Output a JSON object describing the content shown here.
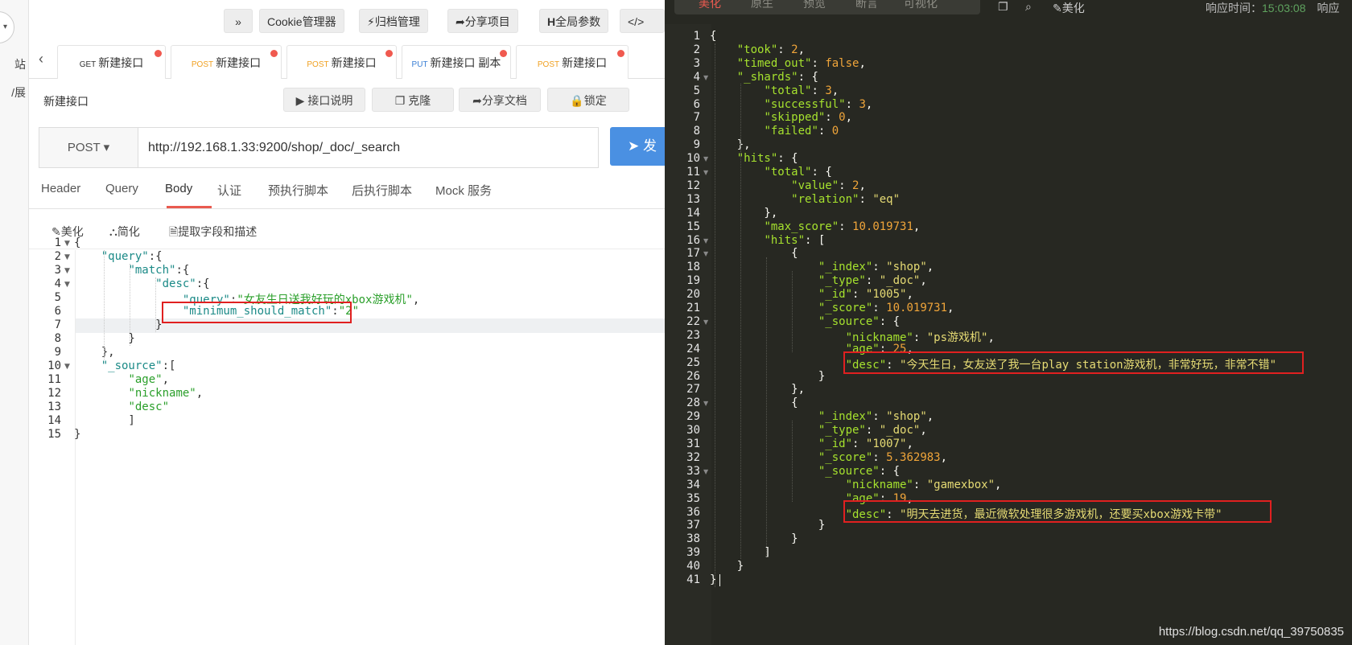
{
  "left_strip": {
    "circle_glyph": "▾",
    "items": [
      "站",
      "/展"
    ]
  },
  "toolbar": {
    "expand_label": "»",
    "cookie_label": "Cookie管理器",
    "archive_label": "归档管理",
    "share_project_label": "分享项目",
    "global_params_label": "全局参数",
    "code_label": "</>"
  },
  "request_tabs": [
    {
      "method": "GET",
      "label": "新建接口",
      "method_color": "#333333",
      "dot": true
    },
    {
      "method": "POST",
      "label": "新建接口",
      "method_color": "#f0a020",
      "dot": true
    },
    {
      "method": "POST",
      "label": "新建接口",
      "method_color": "#f0a020",
      "dot": true
    },
    {
      "method": "PUT",
      "label": "新建接口 副本",
      "method_color": "#3a7fd5",
      "dot": true
    },
    {
      "method": "POST",
      "label": "新建接口",
      "method_color": "#f0a020",
      "dot": true
    }
  ],
  "request": {
    "title": "新建接口",
    "doc_label": "接口说明",
    "clone_label": "克隆",
    "share_doc_label": "分享文档",
    "lock_label": "锁定",
    "method": "POST",
    "url": "http://192.168.1.33:9200/shop/_doc/_search",
    "send_label": "发"
  },
  "subtabs": [
    "Header",
    "Query",
    "Body",
    "认证",
    "预执行脚本",
    "后执行脚本",
    "Mock 服务"
  ],
  "active_subtab": "Body",
  "editor_tools": {
    "beautify": "美化",
    "simplify": "简化",
    "extract": "提取字段和描述"
  },
  "request_body_lines": [
    "{",
    "    \"query\":{",
    "        \"match\":{",
    "            \"desc\":{",
    "                \"query\":\"女友生日送我好玩的xbox游戏机\",",
    "                \"minimum_should_match\":\"2\"",
    "            }",
    "        }",
    "    },",
    "    \"_source\":[",
    "        \"age\",",
    "        \"nickname\",",
    "        \"desc\"",
    "        ]",
    "}"
  ],
  "response_tabs": [
    "美化",
    "原生",
    "预览",
    "断言",
    "可视化"
  ],
  "response_active_tab": "美化",
  "response_tools": {
    "copy_icon": "copy-icon",
    "search_icon": "search-icon",
    "beautify_label": "美化"
  },
  "response_time": {
    "label": "响应时间：",
    "value": "15:03:08",
    "trailing": "响应"
  },
  "response_lines": [
    "{",
    "    \"took\": 2,",
    "    \"timed_out\": false,",
    "    \"_shards\": {",
    "        \"total\": 3,",
    "        \"successful\": 3,",
    "        \"skipped\": 0,",
    "        \"failed\": 0",
    "    },",
    "    \"hits\": {",
    "        \"total\": {",
    "            \"value\": 2,",
    "            \"relation\": \"eq\"",
    "        },",
    "        \"max_score\": 10.019731,",
    "        \"hits\": [",
    "            {",
    "                \"_index\": \"shop\",",
    "                \"_type\": \"_doc\",",
    "                \"_id\": \"1005\",",
    "                \"_score\": 10.019731,",
    "                \"_source\": {",
    "                    \"nickname\": \"ps游戏机\",",
    "                    \"age\": 25,",
    "                    \"desc\": \"今天生日，女友送了我一台play station游戏机，非常好玩，非常不错\"",
    "                }",
    "            },",
    "            {",
    "                \"_index\": \"shop\",",
    "                \"_type\": \"_doc\",",
    "                \"_id\": \"1007\",",
    "                \"_score\": 5.362983,",
    "                \"_source\": {",
    "                    \"nickname\": \"gamexbox\",",
    "                    \"age\": 19,",
    "                    \"desc\": \"明天去进货，最近微软处理很多游戏机，还要买xbox游戏卡带\"",
    "                }",
    "            }",
    "        ]",
    "    }",
    "}"
  ],
  "watermark": "https://blog.csdn.net/qq_39750835",
  "colors": {
    "accent_red": "#e95a4f",
    "send_blue": "#4a90e2",
    "dark_bg": "#272822",
    "highlight_box": "#e02020"
  }
}
